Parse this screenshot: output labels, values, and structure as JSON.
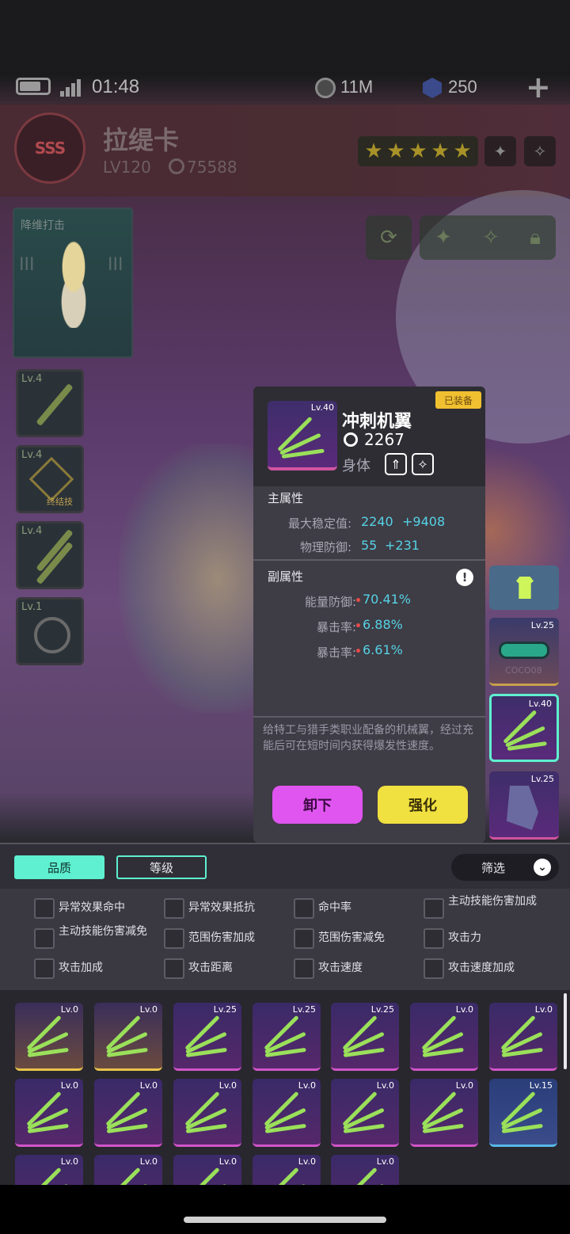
{
  "status_bar": {
    "time": "01:48",
    "currency1_value": "11M",
    "currency2_value": "250",
    "add_symbol": "+"
  },
  "character": {
    "emblem": "SSS",
    "name": "拉缇卡",
    "level": "LV120",
    "power": "75588",
    "stars": 5
  },
  "portrait": {
    "title": "降维打击",
    "roman_left": "III",
    "roman_right": "III"
  },
  "skills": [
    {
      "level": "Lv.4",
      "tag": ""
    },
    {
      "level": "Lv.4",
      "tag": "终结技"
    },
    {
      "level": "Lv.4",
      "tag": ""
    },
    {
      "level": "Lv.1",
      "tag": ""
    }
  ],
  "equipment_slots": [
    {
      "level": "",
      "icon": "shirt-icon"
    },
    {
      "level": "Lv.25",
      "icon": "goggles-icon",
      "watermark": "COCO08"
    },
    {
      "level": "Lv.40",
      "icon": "wing-icon",
      "selected": true
    },
    {
      "level": "Lv.25",
      "icon": "boot-icon"
    }
  ],
  "item": {
    "level": "Lv.40",
    "name": "冲刺机翼",
    "power": "2267",
    "slot": "身体",
    "equipped_badge": "已装备",
    "main_title": "主属性",
    "main_stats": [
      {
        "label": "最大稳定值:",
        "value": "2240",
        "bonus": "+9408"
      },
      {
        "label": "物理防御:",
        "value": "55",
        "bonus": "+231"
      }
    ],
    "sub_title": "副属性",
    "sub_stats": [
      {
        "label": "能量防御:",
        "value": "70.41%"
      },
      {
        "label": "暴击率:",
        "value": "6.88%"
      },
      {
        "label": "暴击率:",
        "value": "6.61%"
      }
    ],
    "description": "给特工与猎手类职业配备的机械翼，经过充能后可在短时间内获得爆发性速度。",
    "unequip_label": "卸下",
    "upgrade_label": "强化"
  },
  "panel": {
    "tab_quality": "品质",
    "tab_level": "等级",
    "filter_label": "筛选",
    "filters": [
      "异常效果命中",
      "异常效果抵抗",
      "命中率",
      "主动技能伤害加成",
      "主动技能伤害减免",
      "范围伤害加成",
      "范围伤害减免",
      "攻击力",
      "攻击加成",
      "攻击距离",
      "攻击速度",
      "攻击速度加成"
    ],
    "items": [
      {
        "level": "Lv.0",
        "rarity": "gold"
      },
      {
        "level": "Lv.0",
        "rarity": "gold"
      },
      {
        "level": "Lv.25",
        "rarity": "pink"
      },
      {
        "level": "Lv.25",
        "rarity": "pink"
      },
      {
        "level": "Lv.25",
        "rarity": "pink"
      },
      {
        "level": "Lv.0",
        "rarity": "pink"
      },
      {
        "level": "Lv.0",
        "rarity": "pink"
      },
      {
        "level": "Lv.0",
        "rarity": "pink"
      },
      {
        "level": "Lv.0",
        "rarity": "pink"
      },
      {
        "level": "Lv.0",
        "rarity": "pink"
      },
      {
        "level": "Lv.0",
        "rarity": "pink"
      },
      {
        "level": "Lv.0",
        "rarity": "pink"
      },
      {
        "level": "Lv.0",
        "rarity": "pink"
      },
      {
        "level": "Lv.15",
        "rarity": "blue"
      },
      {
        "level": "Lv.0",
        "rarity": "pink"
      },
      {
        "level": "Lv.0",
        "rarity": "pink"
      },
      {
        "level": "Lv.0",
        "rarity": "pink"
      },
      {
        "level": "Lv.0",
        "rarity": "pink"
      },
      {
        "level": "Lv.0",
        "rarity": "pink"
      }
    ]
  },
  "colors": {
    "accent_cyan": "#56d2e6",
    "unequip_button": "#e055f0",
    "upgrade_button": "#f0e040",
    "quality_tab": "#5ef0d0"
  }
}
